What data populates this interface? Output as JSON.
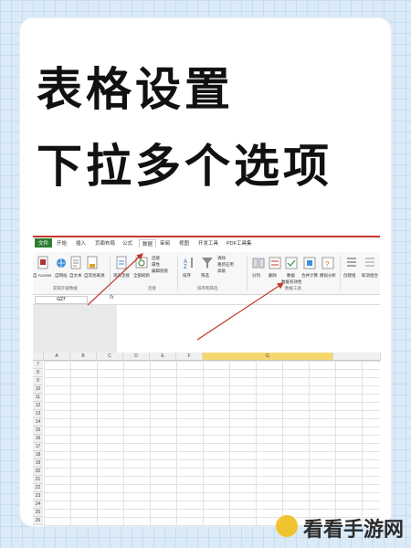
{
  "headline": {
    "line1": "表格设置",
    "line2": "下拉多个选项"
  },
  "excel": {
    "tabs": [
      "文件",
      "开始",
      "插入",
      "页面布局",
      "公式",
      "数据",
      "审阅",
      "视图",
      "开发工具",
      "PDF工具集"
    ],
    "active_tab": "数据",
    "ribbon": {
      "buttons": [
        "自 Access",
        "自网站",
        "自文本",
        "自其他来源",
        "现有连接",
        "全部刷新",
        "排序",
        "筛选",
        "分列",
        "删除",
        "数据",
        "合并计算",
        "模拟分析",
        "创建组",
        "取消组合"
      ],
      "small_buttons": [
        "连接",
        "属性",
        "编辑链接",
        "清除",
        "重新应用",
        "高级",
        "数据有效性"
      ],
      "groups": [
        "获取外部数据",
        "连接",
        "排序和筛选",
        "数据工具"
      ]
    },
    "name_box": "G27",
    "fx_label": "fx",
    "columns": [
      "A",
      "B",
      "C",
      "D",
      "E",
      "F",
      "G"
    ],
    "selected_column": "G",
    "rows": [
      "7",
      "8",
      "9",
      "10",
      "11",
      "12",
      "13",
      "14",
      "15",
      "16",
      "17",
      "18",
      "19",
      "20",
      "21",
      "22",
      "23",
      "24",
      "25",
      "26",
      "27"
    ],
    "colors": {
      "accent_red": "#c0392b",
      "file_tab": "#2e7d32",
      "selected_col": "#f5d76e"
    }
  },
  "watermark": {
    "text": "看看手游网"
  }
}
